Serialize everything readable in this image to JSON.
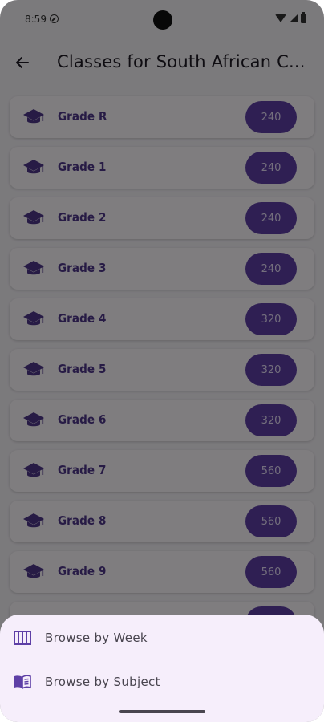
{
  "status_bar": {
    "time": "8:59"
  },
  "app_bar": {
    "title": "Classes for South African C..."
  },
  "grades": [
    {
      "label": "Grade R",
      "count": "240"
    },
    {
      "label": "Grade 1",
      "count": "240"
    },
    {
      "label": "Grade 2",
      "count": "240"
    },
    {
      "label": "Grade 3",
      "count": "240"
    },
    {
      "label": "Grade 4",
      "count": "320"
    },
    {
      "label": "Grade 5",
      "count": "320"
    },
    {
      "label": "Grade 6",
      "count": "320"
    },
    {
      "label": "Grade 7",
      "count": "560"
    },
    {
      "label": "Grade 8",
      "count": "560"
    },
    {
      "label": "Grade 9",
      "count": "560"
    }
  ],
  "bottom_sheet": {
    "items": [
      {
        "label": "Browse by Week",
        "icon": "calendar-week-icon"
      },
      {
        "label": "Browse by Subject",
        "icon": "book-icon"
      }
    ]
  },
  "colors": {
    "accent": "#5e3fa6",
    "label": "#4f378b",
    "card": "#fefbff",
    "sheet": "#f6eefb"
  }
}
